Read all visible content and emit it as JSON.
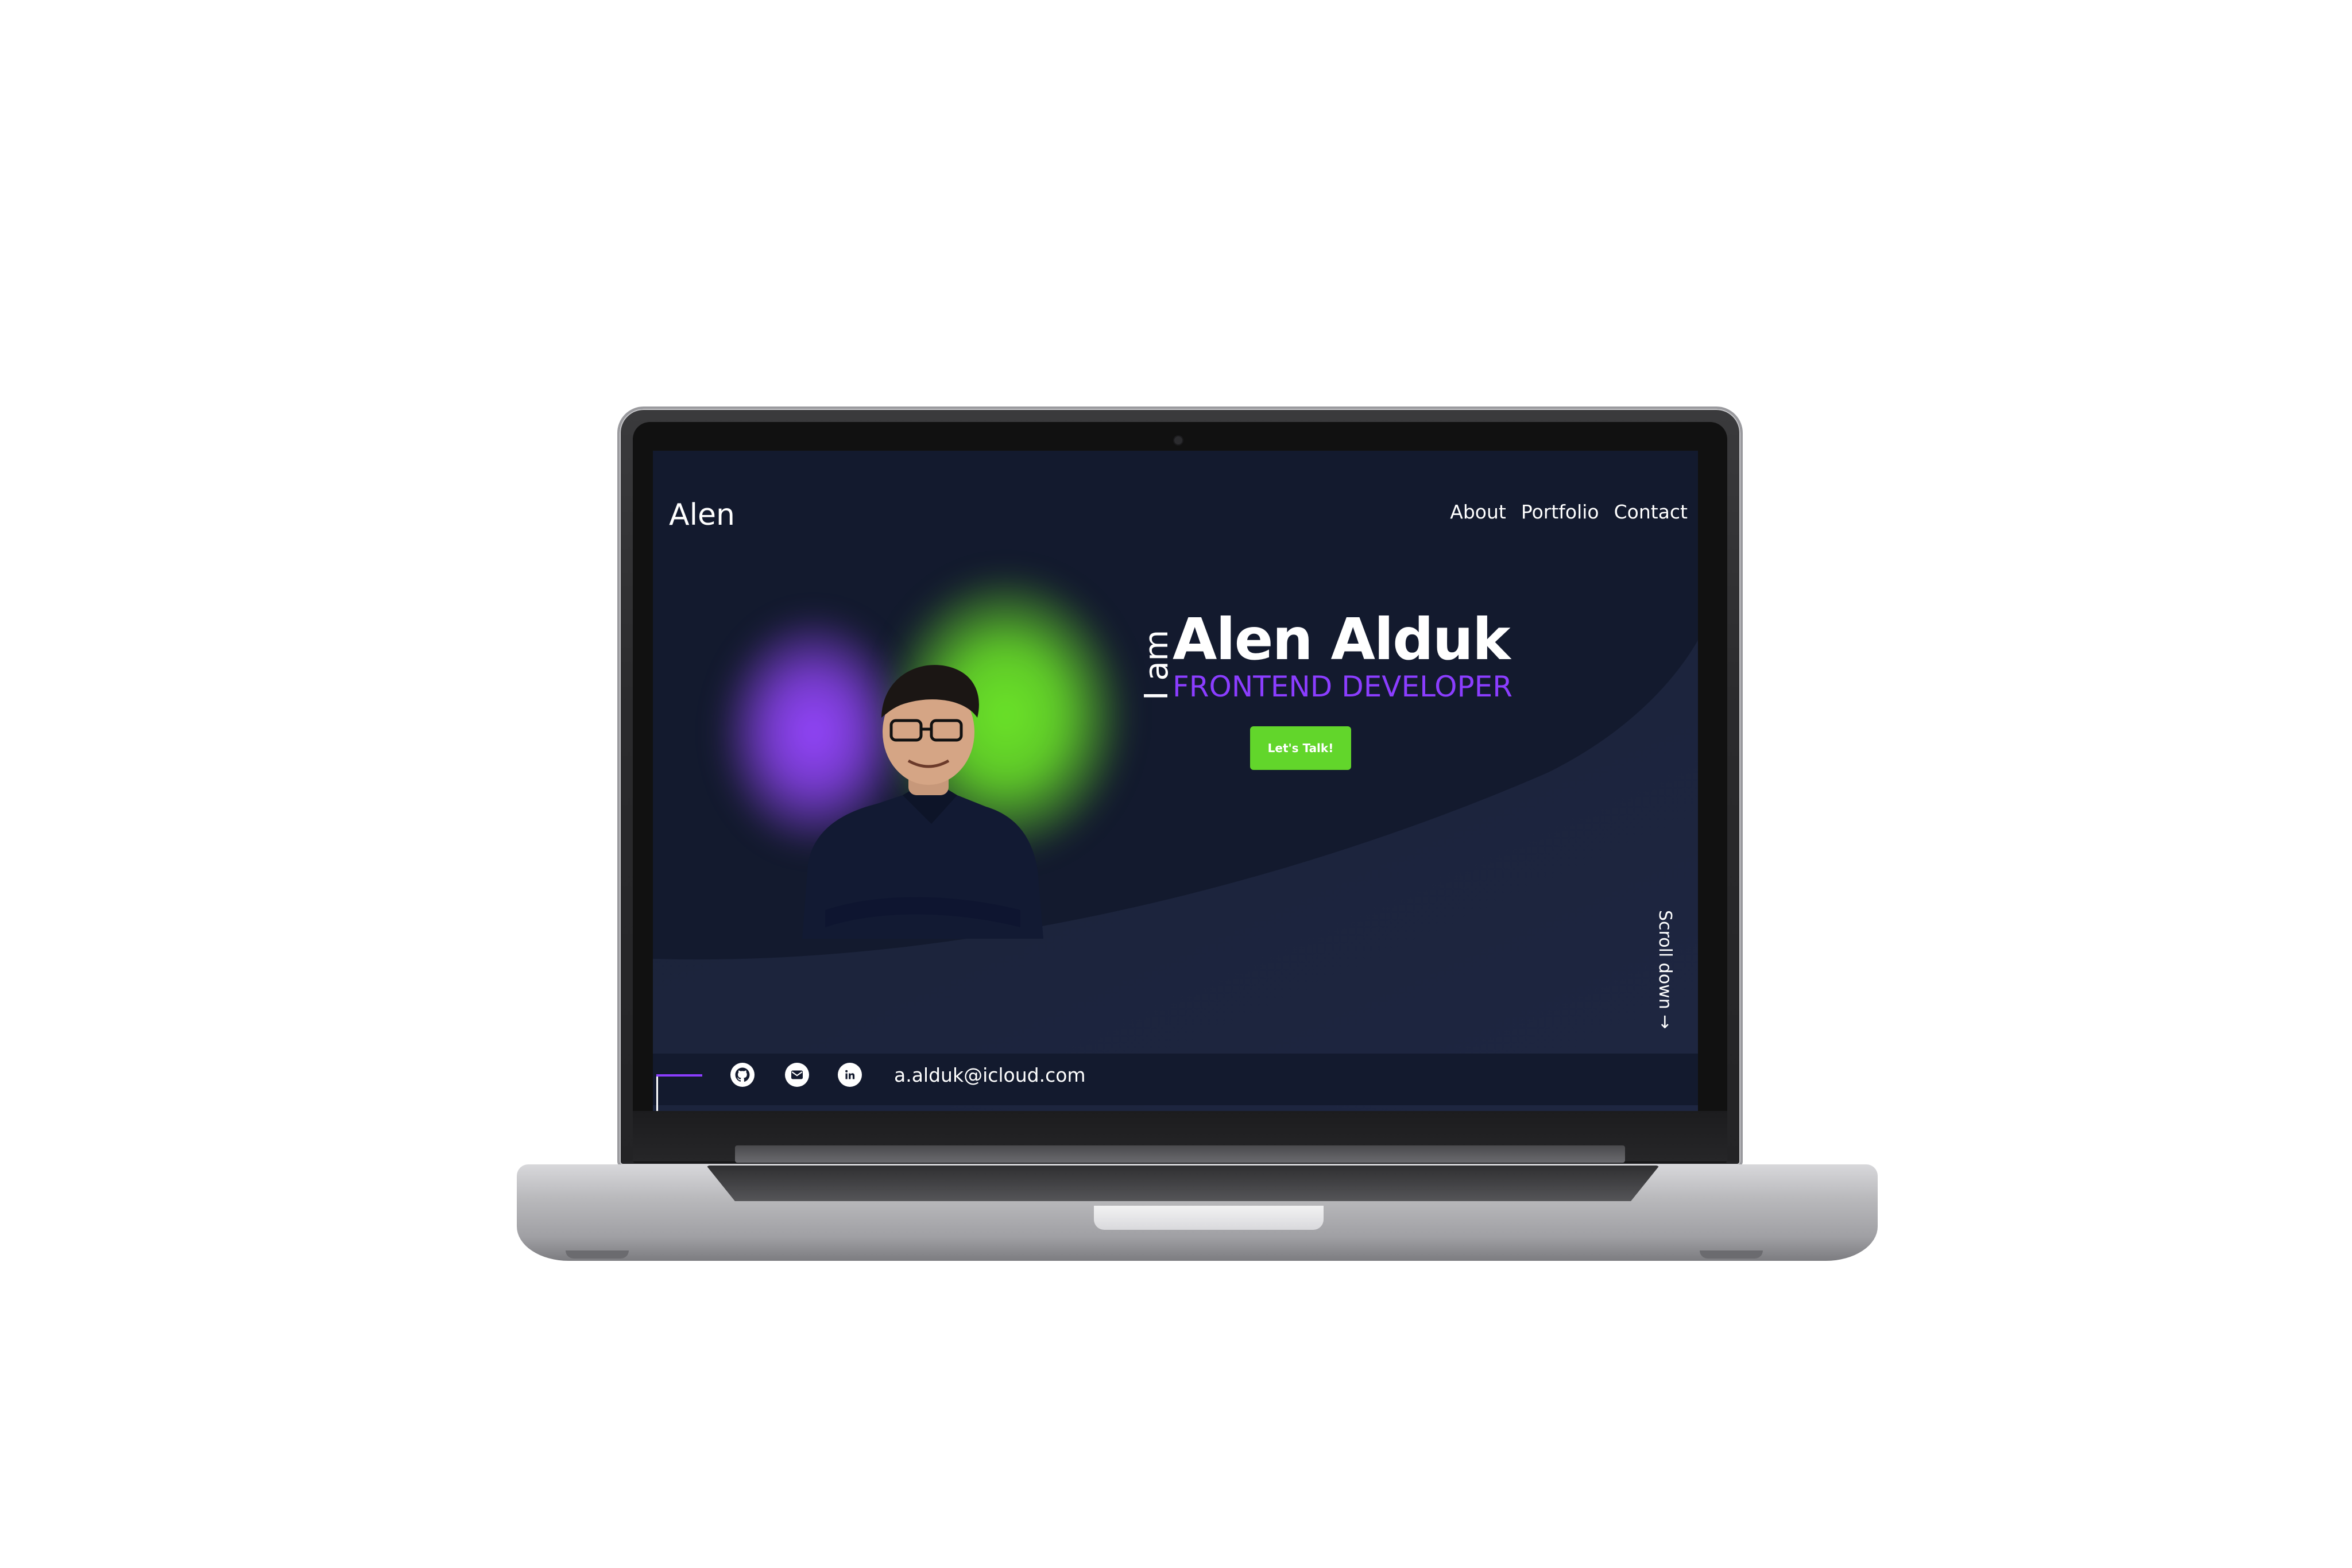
{
  "site": {
    "brand": "Alen",
    "nav": [
      "About",
      "Portfolio",
      "Contact"
    ]
  },
  "hero": {
    "prefix": "I am",
    "name": "Alen Alduk",
    "role": "FRONTEND DEVELOPER",
    "cta_label": "Let's Talk!",
    "scroll_label": "Scroll down →"
  },
  "footer": {
    "email": "a.alduk@icloud.com",
    "icons": [
      "github-icon",
      "mail-icon",
      "linkedin-icon"
    ]
  },
  "colors": {
    "background": "#131a2e",
    "accent_purple": "#8b3dff",
    "accent_green": "#62d62b"
  }
}
